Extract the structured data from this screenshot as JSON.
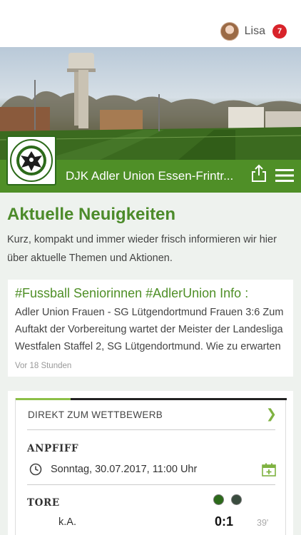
{
  "user": {
    "name": "Lisa",
    "notifications": "7"
  },
  "club": {
    "name": "DJK Adler Union Essen-Frintrop e.V.",
    "display_name": "DJK Adler Union Essen-Frintr..."
  },
  "section": {
    "title": "Aktuelle Neuigkeiten",
    "description": "Kurz, kompakt und immer wieder frisch informieren wir hier über aktuelle Themen und Aktionen."
  },
  "news": {
    "title": "#Fussball Seniorinnen #AdlerUnion Info :",
    "body": "Adler Union Frauen - SG Lütgendortmund Frauen 3:6 Zum Auftakt der Vorbereitung wartet der Meister der Landesliga Westfalen Staffel 2, SG Lütgendortmund. Wie zu erwarten",
    "time": "Vor 18 Stunden"
  },
  "match": {
    "competition_link": "DIREKT ZUM WETTBEWERB",
    "anpfiff_label": "ANPFIFF",
    "datetime": "Sonntag, 30.07.2017, 11:00 Uhr",
    "tore_label": "TORE",
    "scorer": "k.A.",
    "score": "0:1",
    "minute": "39'"
  },
  "colors": {
    "brand_green": "#4f8f27",
    "accent_green": "#8cbf47",
    "badge_red": "#d8232a"
  }
}
